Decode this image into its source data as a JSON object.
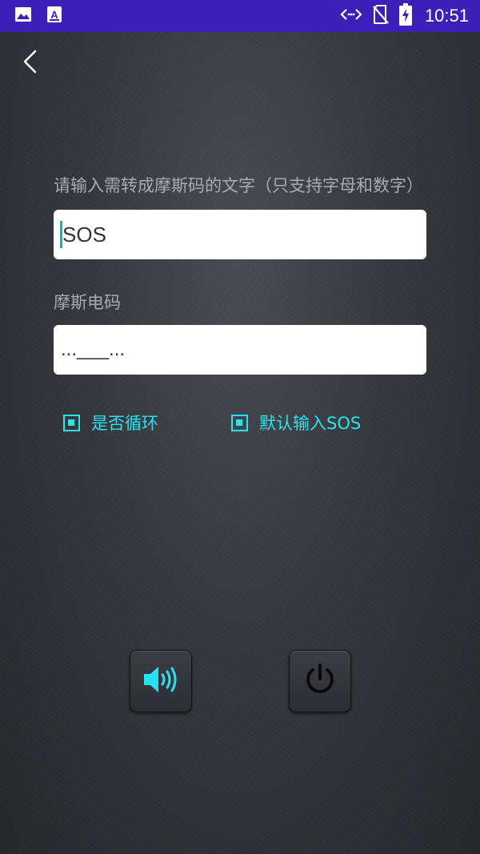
{
  "status_bar": {
    "time": "10:51",
    "icons": [
      "gallery-icon",
      "font-app-icon",
      "data-arrows-icon",
      "no-sim-icon",
      "battery-charging-icon"
    ]
  },
  "nav": {
    "back_icon": "chevron-left-icon"
  },
  "form": {
    "text_label": "请输入需转成摩斯码的文字（只支持字母和数字）",
    "text_value": "SOS",
    "morse_label": "摩斯电码",
    "morse_value": "...___..."
  },
  "options": {
    "loop_label": "是否循环",
    "loop_checked": true,
    "default_sos_label": "默认输入SOS",
    "default_sos_checked": true
  },
  "controls": {
    "sound_icon": "speaker-icon",
    "power_icon": "power-icon"
  },
  "colors": {
    "status_bar": "#3a1fb8",
    "accent": "#27e3f0",
    "label": "#a9abb0",
    "caret": "#19b5a8"
  }
}
